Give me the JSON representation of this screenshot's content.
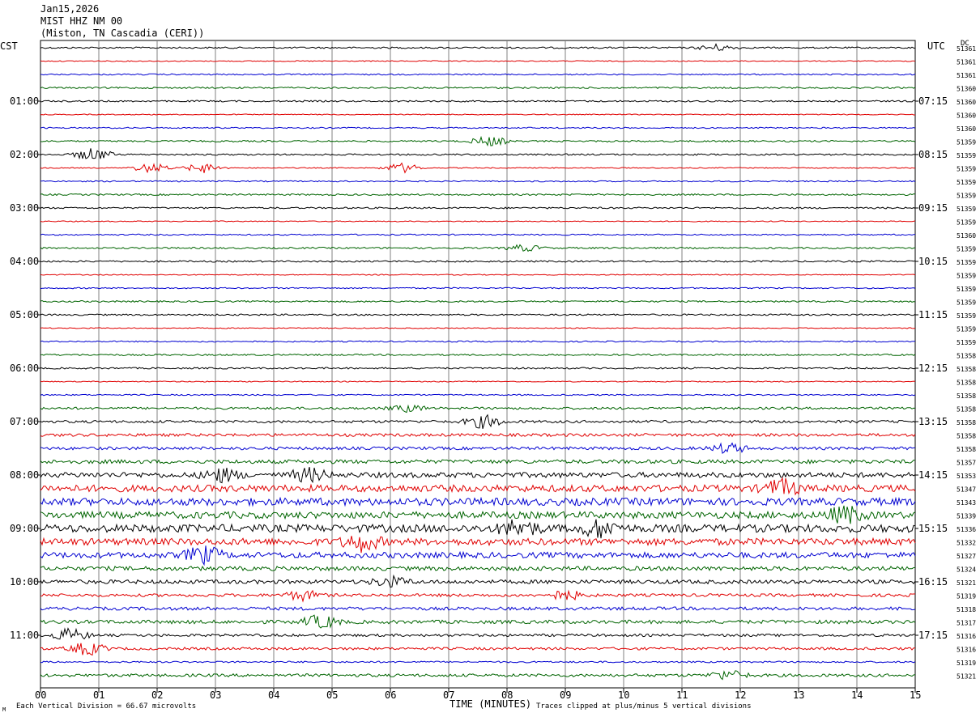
{
  "header": {
    "line1": "Jan15,2026",
    "line2": "MIST HHZ NM 00",
    "line3": "(Miston, TN Cascadia (CERI))"
  },
  "axis_labels": {
    "left_tz": "CST",
    "right_tz": "UTC",
    "dc": "DC",
    "xlabel": "TIME (MINUTES)"
  },
  "footer": {
    "scale_note": "Each Vertical Division =   66.67 microvolts",
    "clip_note": "Traces clipped at plus/minus 5 vertical divisions",
    "mark": "M"
  },
  "colors": {
    "cycle": [
      "#000000",
      "#e00000",
      "#0000d0",
      "#006400"
    ],
    "grid": "#808080"
  },
  "chart_data": {
    "type": "line",
    "title": "",
    "x_ticks": [
      "00",
      "01",
      "02",
      "03",
      "04",
      "05",
      "06",
      "07",
      "08",
      "09",
      "10",
      "11",
      "12",
      "13",
      "14",
      "15"
    ],
    "xlim": [
      0,
      15
    ],
    "trace_minutes": 15,
    "left_hour_labels": [
      "01:00",
      "02:00",
      "03:00",
      "04:00",
      "05:00",
      "06:00",
      "07:00",
      "08:00",
      "09:00",
      "10:00",
      "11:00"
    ],
    "right_hour_labels": [
      "07:15",
      "08:15",
      "09:15",
      "10:15",
      "11:15",
      "12:15",
      "13:15",
      "14:15",
      "15:15",
      "16:15",
      "17:15"
    ],
    "dc_values": [
      "51361",
      "51361",
      "51361",
      "51360",
      "51360",
      "51360",
      "51360",
      "51359",
      "51359",
      "51359",
      "51359",
      "51359",
      "51359",
      "51359",
      "51360",
      "51359",
      "51359",
      "51359",
      "51359",
      "51359",
      "51359",
      "51359",
      "51359",
      "51358",
      "51358",
      "51358",
      "51358",
      "51358",
      "51358",
      "51358",
      "51358",
      "51357",
      "51353",
      "51347",
      "51343",
      "51339",
      "51336",
      "51332",
      "51327",
      "51324",
      "51321",
      "51319",
      "51318",
      "51317",
      "51316",
      "51316",
      "51319",
      "51321"
    ],
    "trace_amplitude": [
      1,
      0.6,
      0.8,
      1,
      1,
      0.6,
      0.8,
      1,
      1,
      0.6,
      0.8,
      1,
      1,
      0.6,
      0.8,
      1,
      1,
      0.6,
      0.8,
      1,
      1,
      0.6,
      0.8,
      1,
      1,
      0.6,
      0.8,
      1.4,
      1.6,
      1.8,
      1.8,
      2.4,
      3.2,
      4.2,
      4.6,
      4.2,
      4.8,
      4.2,
      3.6,
      2.6,
      2.4,
      1.8,
      2.0,
      2.2,
      1.6,
      1.6,
      1.0,
      1.8
    ],
    "events": [
      {
        "trace": 0,
        "minute": 11.6,
        "size": 2
      },
      {
        "trace": 7,
        "minute": 7.7,
        "size": 3
      },
      {
        "trace": 8,
        "minute": 0.9,
        "size": 4
      },
      {
        "trace": 9,
        "minute": 1.9,
        "size": 3
      },
      {
        "trace": 9,
        "minute": 2.8,
        "size": 3
      },
      {
        "trace": 9,
        "minute": 6.2,
        "size": 3
      },
      {
        "trace": 15,
        "minute": 8.3,
        "size": 2
      },
      {
        "trace": 27,
        "minute": 6.3,
        "size": 2
      },
      {
        "trace": 28,
        "minute": 7.6,
        "size": 4
      },
      {
        "trace": 30,
        "minute": 11.8,
        "size": 3
      },
      {
        "trace": 32,
        "minute": 3.1,
        "size": 4
      },
      {
        "trace": 32,
        "minute": 4.6,
        "size": 4
      },
      {
        "trace": 33,
        "minute": 12.7,
        "size": 5
      },
      {
        "trace": 35,
        "minute": 13.8,
        "size": 5
      },
      {
        "trace": 36,
        "minute": 8.2,
        "size": 5
      },
      {
        "trace": 36,
        "minute": 9.6,
        "size": 5
      },
      {
        "trace": 37,
        "minute": 5.5,
        "size": 5
      },
      {
        "trace": 38,
        "minute": 2.8,
        "size": 5
      },
      {
        "trace": 40,
        "minute": 6.0,
        "size": 3
      },
      {
        "trace": 41,
        "minute": 4.5,
        "size": 3
      },
      {
        "trace": 41,
        "minute": 9.0,
        "size": 3
      },
      {
        "trace": 43,
        "minute": 4.8,
        "size": 4
      },
      {
        "trace": 44,
        "minute": 0.5,
        "size": 4
      },
      {
        "trace": 45,
        "minute": 0.8,
        "size": 4
      },
      {
        "trace": 47,
        "minute": 11.8,
        "size": 3
      }
    ]
  }
}
